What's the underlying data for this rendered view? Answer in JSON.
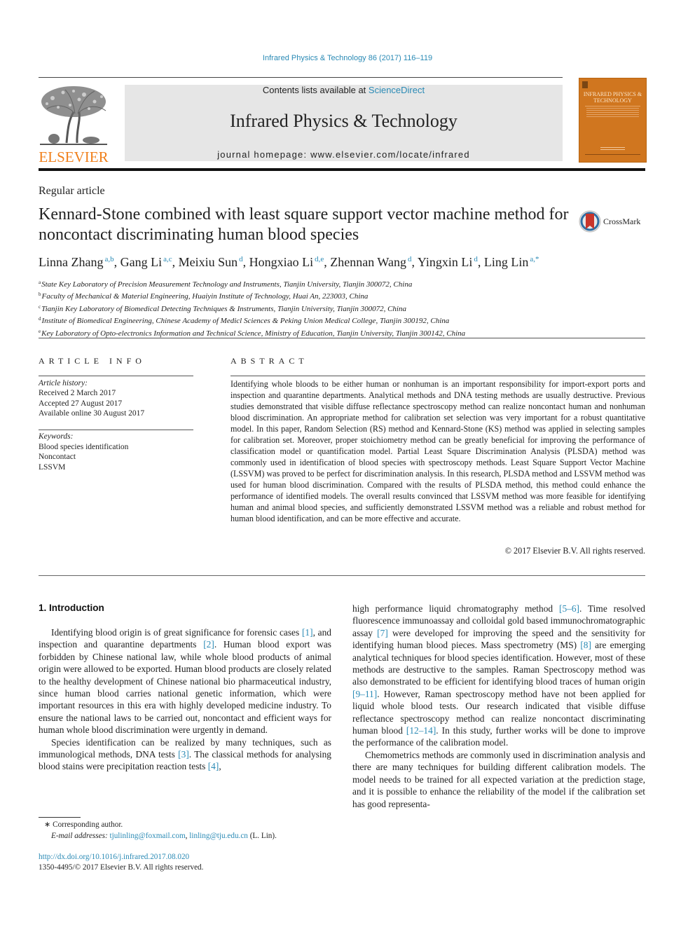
{
  "header": {
    "journal_reference": "Infrared Physics & Technology 86 (2017) 116–119",
    "publisher_wordmark": "ELSEVIER",
    "contents_prefix": "Contents lists available at ",
    "contents_link": "ScienceDirect",
    "journal_title": "Infrared Physics & Technology",
    "homepage": "journal homepage: www.elsevier.com/locate/infrared",
    "cover_title": "INFRARED PHYSICS & TECHNOLOGY",
    "colors": {
      "brand_orange": "#f07f1a",
      "cover_orange": "#d0761f",
      "link_blue": "#2a8ab5",
      "masthead_gray": "#e6e6e6"
    }
  },
  "article": {
    "type": "Regular article",
    "title": "Kennard-Stone combined with least square support vector machine method for noncontact discriminating human blood species",
    "crossmark_label": "CrossMark",
    "authors": [
      {
        "name": "Linna Zhang",
        "sup": "a,b",
        "sep": ", "
      },
      {
        "name": "Gang Li",
        "sup": "a,c",
        "sep": ", "
      },
      {
        "name": "Meixiu Sun",
        "sup": "d",
        "sep": ", "
      },
      {
        "name": "Hongxiao Li",
        "sup": "d,e",
        "sep": ", "
      },
      {
        "name": "Zhennan Wang",
        "sup": "d",
        "sep": ", "
      },
      {
        "name": "Yingxin Li",
        "sup": "d",
        "sep": ", "
      },
      {
        "name": "Ling Lin",
        "sup": "a,*",
        "sep": ""
      }
    ],
    "affiliations": [
      {
        "key": "a",
        "text": "State Key Laboratory of Precision Measurement Technology and Instruments, Tianjin University, Tianjin 300072, China"
      },
      {
        "key": "b",
        "text": "Faculty of Mechanical & Material Engineering, Huaiyin Institute of Technology, Huai An, 223003, China"
      },
      {
        "key": "c",
        "text": "Tianjin Key Laboratory of Biomedical Detecting Techniques & Instruments, Tianjin University, Tianjin 300072, China"
      },
      {
        "key": "d",
        "text": "Institute of Biomedical Engineering, Chinese Academy of Medicl Sciences & Peking Union Medical College, Tianjin 300192, China"
      },
      {
        "key": "e",
        "text": "Key Laboratory of Opto-electronics Information and Technical Science, Ministry of Education, Tianjin University, Tianjin 300142, China"
      }
    ]
  },
  "article_info": {
    "heading": "ARTICLE INFO",
    "history_label": "Article history:",
    "received": "Received 2 March 2017",
    "accepted": "Accepted 27 August 2017",
    "online": "Available online 30 August 2017",
    "keywords_label": "Keywords:",
    "keywords": [
      "Blood species identification",
      "Noncontact",
      "LSSVM"
    ]
  },
  "abstract": {
    "heading": "ABSTRACT",
    "text": "Identifying whole bloods to be either human or nonhuman is an important responsibility for import-export ports and inspection and quarantine departments. Analytical methods and DNA testing methods are usually destructive. Previous studies demonstrated that visible diffuse reflectance spectroscopy method can realize noncontact human and nonhuman blood discrimination. An appropriate method for calibration set selection was very important for a robust quantitative model. In this paper, Random Selection (RS) method and Kennard-Stone (KS) method was applied in selecting samples for calibration set. Moreover, proper stoichiometry method can be greatly beneficial for improving the performance of classification model or quantification model. Partial Least Square Discrimination Analysis (PLSDA) method was commonly used in identification of blood species with spectroscopy methods. Least Square Support Vector Machine (LSSVM) was proved to be perfect for discrimination analysis. In this research, PLSDA method and LSSVM method was used for human blood discrimination. Compared with the results of PLSDA method, this method could enhance the performance of identified models. The overall results convinced that LSSVM method was more feasible for identifying human and animal blood species, and sufficiently demonstrated LSSVM method was a reliable and robust method for human blood identification, and can be more effective and accurate.",
    "copyright": "© 2017 Elsevier B.V. All rights reserved."
  },
  "introduction": {
    "heading": "1. Introduction",
    "left": [
      [
        {
          "t": "Identifying blood origin is of great significance for forensic cases "
        },
        {
          "ref": "[1]"
        },
        {
          "t": ", and inspection and quarantine departments "
        },
        {
          "ref": "[2]"
        },
        {
          "t": ". Human blood export was forbidden by Chinese national law, while whole blood products of animal origin were allowed to be exported. Human blood products are closely related to the healthy development of Chinese national bio pharmaceutical industry, since human blood carries national genetic information, which were important resources in this era with highly developed medicine industry. To ensure the national laws to be carried out, noncontact and efficient ways for human whole blood discrimination were urgently in demand."
        }
      ],
      [
        {
          "t": "Species identification can be realized by many techniques, such as immunological methods, DNA tests "
        },
        {
          "ref": "[3]"
        },
        {
          "t": ". The classical methods for analysing blood stains were precipitation reaction tests "
        },
        {
          "ref": "[4]"
        },
        {
          "t": ","
        }
      ]
    ],
    "right": [
      [
        {
          "t": "high performance liquid chromatography method "
        },
        {
          "ref": "[5–6]"
        },
        {
          "t": ". Time resolved fluorescence immunoassay and colloidal gold based immunochromatographic assay "
        },
        {
          "ref": "[7]"
        },
        {
          "t": " were developed for improving the speed and the sensitivity for identifying human blood pieces. Mass spectrometry (MS) "
        },
        {
          "ref": "[8]"
        },
        {
          "t": " are emerging analytical techniques for blood species identification. However, most of these methods are destructive to the samples. Raman Spectroscopy method was also demonstrated to be efficient for identifying blood traces of human origin "
        },
        {
          "ref": "[9–11]"
        },
        {
          "t": ". However, Raman spectroscopy method have not been applied for liquid whole blood tests. Our research indicated that visible diffuse reflectance spectroscopy method can realize noncontact discriminating human blood "
        },
        {
          "ref": "[12–14]"
        },
        {
          "t": ". In this study, further works will be done to improve the performance of the calibration model."
        }
      ],
      [
        {
          "t": "Chemometrics methods are commonly used in discrimination analysis and there are many techniques for building different calibration models. The model needs to be trained for all expected variation at the prediction stage, and it is possible to enhance the reliability of the model if the calibration set has good representa-"
        }
      ]
    ]
  },
  "footnotes": {
    "corresponding": "Corresponding author.",
    "email_label": "E-mail addresses: ",
    "email1": "tjulinling@foxmail.com",
    "email2": "linling@tju.edu.cn",
    "email_suffix": " (L. Lin).",
    "doi": "http://dx.doi.org/10.1016/j.infrared.2017.08.020",
    "issn": "1350-4495/© 2017 Elsevier B.V. All rights reserved."
  }
}
